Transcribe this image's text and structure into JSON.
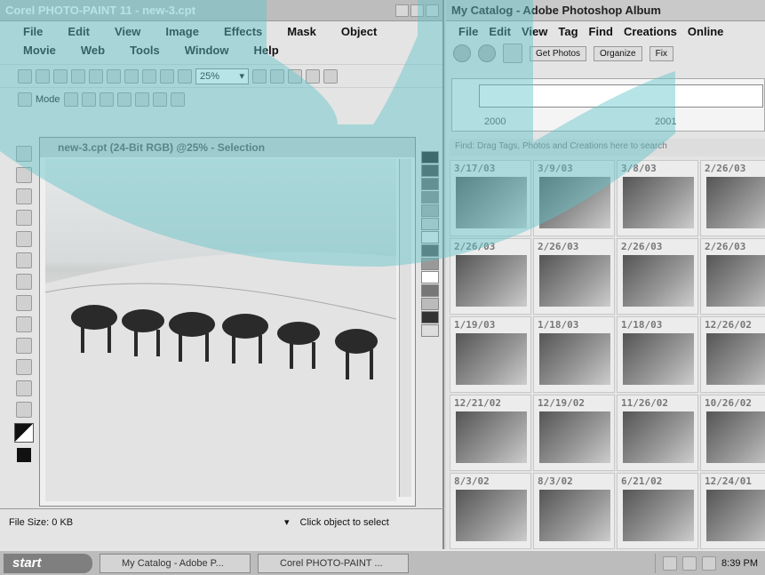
{
  "corel": {
    "title": "Corel PHOTO-PAINT 11 - new-3.cpt",
    "menu": [
      "File",
      "Edit",
      "View",
      "Image",
      "Effects",
      "Mask",
      "Object",
      "Movie",
      "Web",
      "Tools",
      "Window",
      "Help"
    ],
    "zoom": "25%",
    "mode_label": "Mode",
    "doc_title": "new-3.cpt (24-Bit RGB) @25% - Selection",
    "status_size": "File Size: 0 KB",
    "status_hint": "Click object to select"
  },
  "album": {
    "title": "My Catalog - Adobe Photoshop Album",
    "menu": [
      "File",
      "Edit",
      "View",
      "Tag",
      "Find",
      "Creations",
      "Online"
    ],
    "get_photos": "Get Photos",
    "organize": "Organize",
    "fix": "Fix",
    "years": [
      "2000",
      "2001"
    ],
    "find_hint": "Find: Drag Tags, Photos and Creations here to search",
    "photos": [
      "3/17/03",
      "3/9/03",
      "3/8/03",
      "2/26/03",
      "2/26/03",
      "2/26/03",
      "2/26/03",
      "2/26/03",
      "1/19/03",
      "1/18/03",
      "1/18/03",
      "12/26/02",
      "12/21/02",
      "12/19/02",
      "11/26/02",
      "10/26/02",
      "8/3/02",
      "8/3/02",
      "6/21/02",
      "12/24/01"
    ]
  },
  "taskbar": {
    "start": "start",
    "task1": "My Catalog - Adobe P...",
    "task2": "Corel PHOTO-PAINT ...",
    "clock": "8:39 PM"
  },
  "colors": {
    "overlay": "#5fc4c8"
  }
}
